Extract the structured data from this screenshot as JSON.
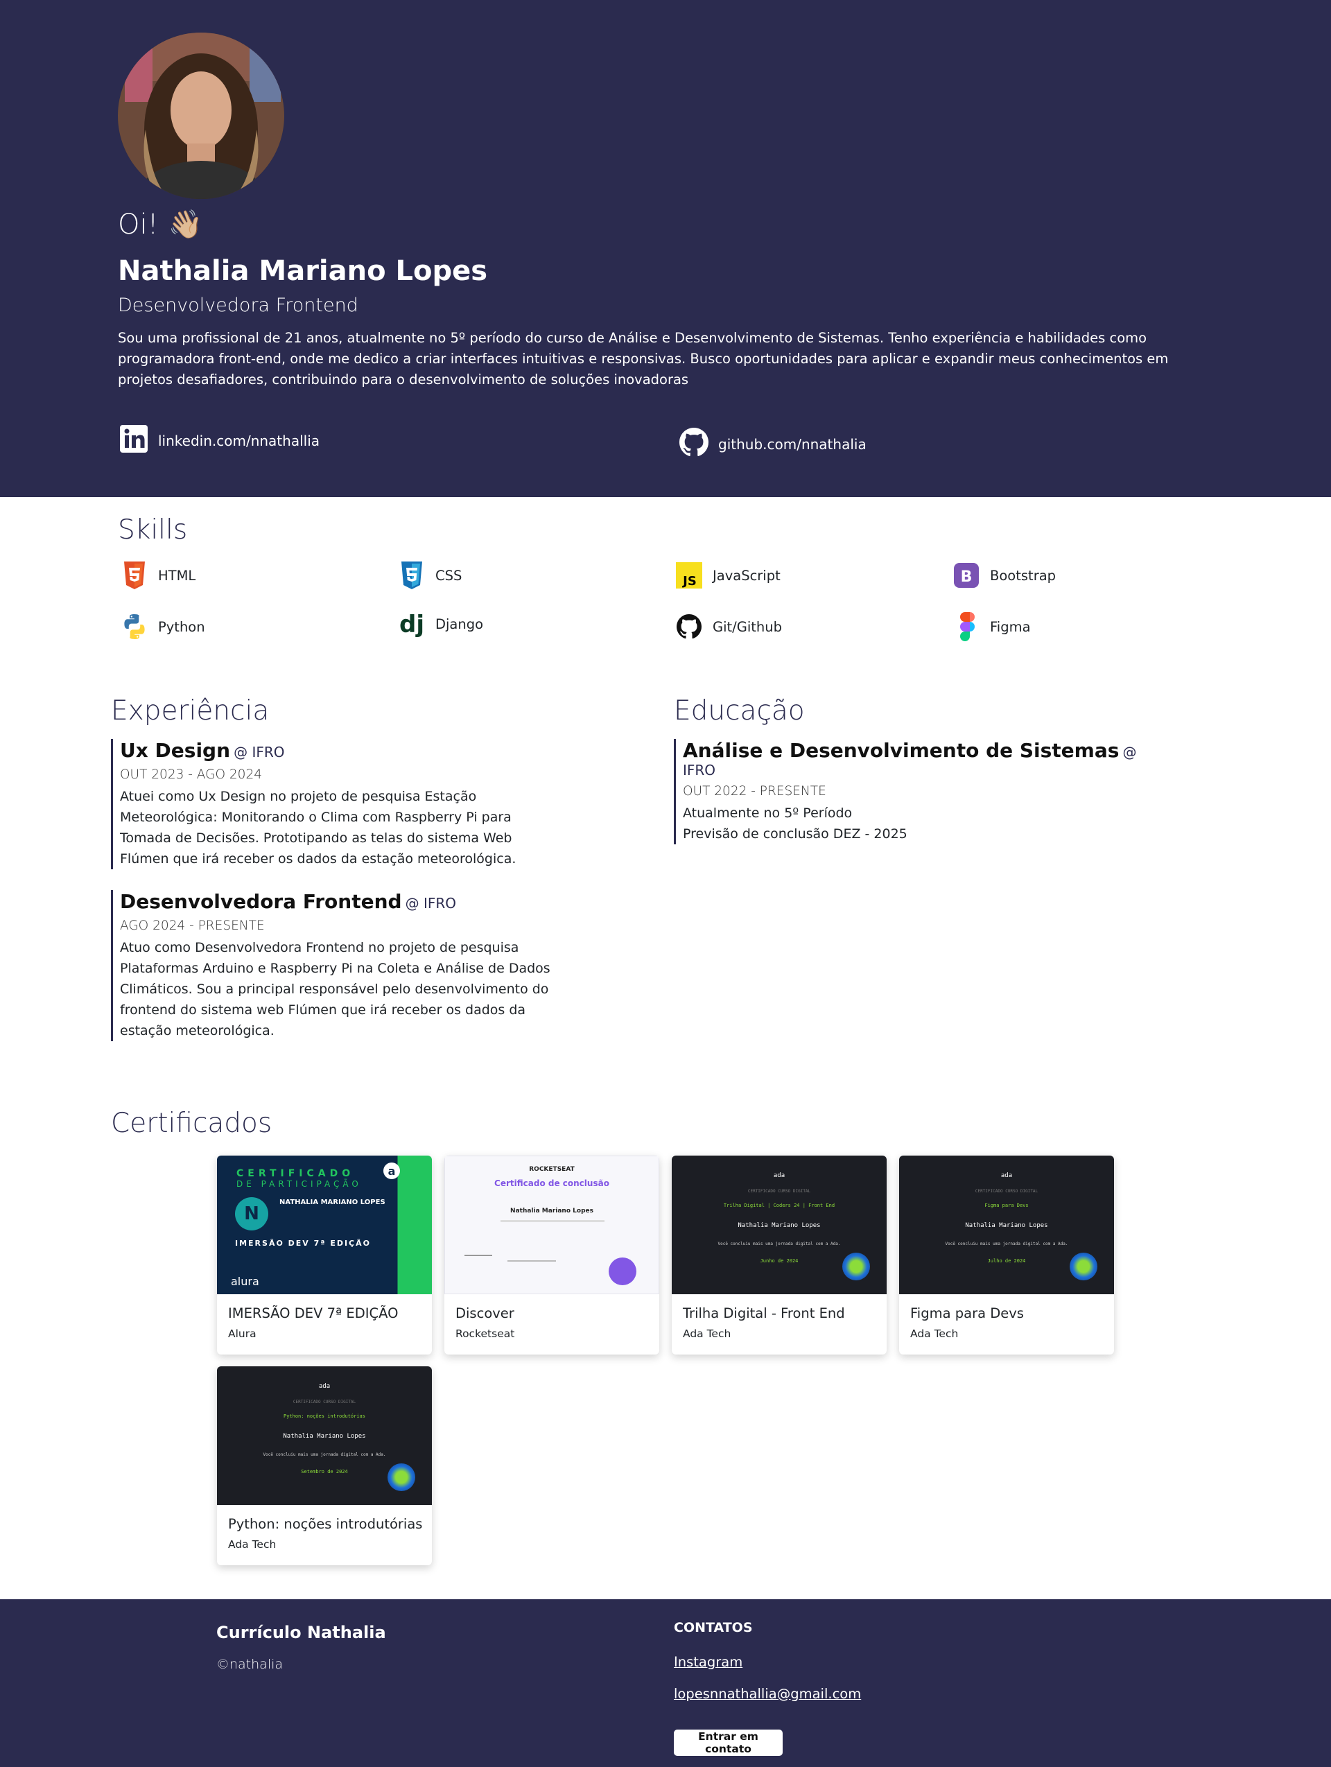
{
  "hero": {
    "greeting": "Oi!",
    "wave_emoji": "👋🏼",
    "name": "Nathalia Mariano Lopes",
    "role": "Desenvolvedora Frontend",
    "bio": "Sou uma profissional de 21 anos, atualmente no 5º período do curso de Análise e Desenvolvimento de Sistemas. Tenho experiência e habilidades como programadora front-end, onde me dedico a criar interfaces intuitivas e responsivas. Busco oportunidades para aplicar e expandir meus conhecimentos em projetos desafiadores, contribuindo para o desenvolvimento de soluções inovadoras",
    "linkedin_label": "linkedin.com/nnathallia",
    "linkedin_icon": "linkedin-icon",
    "github_label": "github.com/nnathalia",
    "github_icon": "github-icon"
  },
  "skills": {
    "title": "Skills",
    "items": [
      {
        "label": "HTML",
        "icon": "html5-icon"
      },
      {
        "label": "CSS",
        "icon": "css3-icon"
      },
      {
        "label": "JavaScript",
        "icon": "javascript-icon"
      },
      {
        "label": "Bootstrap",
        "icon": "bootstrap-icon"
      },
      {
        "label": "Python",
        "icon": "python-icon"
      },
      {
        "label": "Django",
        "icon": "django-icon"
      },
      {
        "label": "Git/Github",
        "icon": "github-icon"
      },
      {
        "label": "Figma",
        "icon": "figma-icon"
      }
    ]
  },
  "experience": {
    "title": "Experiência",
    "items": [
      {
        "title": "Ux Design",
        "org": "@ IFRO",
        "dates": "OUT 2023 - AGO 2024",
        "description": "Atuei como Ux Design no projeto de pesquisa Estação Meteorológica: Monitorando o Clima com Raspberry Pi para Tomada de Decisões. Prototipando as telas do sistema Web Flúmen que irá receber os dados da estação meteorológica."
      },
      {
        "title": "Desenvolvedora Frontend",
        "org": "@ IFRO",
        "dates": "AGO 2024 - PRESENTE",
        "description": "Atuo como Desenvolvedora Frontend no projeto de pesquisa Plataformas Arduino e Raspberry Pi na Coleta e Análise de Dados Climáticos. Sou a principal responsável pelo desenvolvimento do frontend do sistema web Flúmen que irá receber os dados da estação meteorológica."
      }
    ]
  },
  "education": {
    "title": "Educação",
    "items": [
      {
        "title": "Análise e Desenvolvimento de Sistemas",
        "org": "@ IFRO",
        "dates": "OUT 2022 - PRESENTE",
        "line1": "Atualmente no 5º Período",
        "line2": "Previsão de conclusão DEZ - 2025"
      }
    ]
  },
  "certificates": {
    "title": "Certificados",
    "items": [
      {
        "title": "IMERSÃO DEV 7ª EDIÇÃO",
        "issuer": "Alura"
      },
      {
        "title": "Discover",
        "issuer": "Rocketseat"
      },
      {
        "title": "Trilha Digital - Front End",
        "issuer": "Ada Tech"
      },
      {
        "title": "Figma para Devs",
        "issuer": "Ada Tech"
      },
      {
        "title": "Python: noções introdutórias",
        "issuer": "Ada Tech"
      }
    ],
    "alura_img": {
      "heading1": "CERTIFICADO",
      "heading2": "DE PARTICIPAÇÃO",
      "name": "NATHALIA MARIANO LOPES",
      "edition": "IMERSÃO DEV 7ª EDIÇÃO",
      "brand": "alura",
      "badge_letter": "N",
      "corner_letter": "a"
    },
    "rocket_img": {
      "brand": "ROCKETSEAT",
      "heading": "Certificado de conclusão",
      "name": "Nathalia Mariano Lopes"
    },
    "ada_imgs": [
      {
        "brand": "ada",
        "header": "CERTIFICADO CURSO DIGITAL",
        "course": "Trilha Digital | Coders 24 | Front End",
        "name": "Nathalia Mariano Lopes",
        "line": "Você concluiu mais uma jornada digital com a Ada.",
        "date": "Junho de 2024"
      },
      {
        "brand": "ada",
        "header": "CERTIFICADO CURSO DIGITAL",
        "course": "Figma para Devs",
        "name": "Nathalia Mariano Lopes",
        "line": "Você concluiu mais uma jornada digital com a Ada.",
        "date": "Julho de 2024"
      },
      {
        "brand": "ada",
        "header": "CERTIFICADO CURSO DIGITAL",
        "course": "Python: noções introdutórias",
        "name": "Nathalia Mariano Lopes",
        "line": "Você concluiu mais uma jornada digital com a Ada.",
        "date": "Setembro de 2024"
      }
    ]
  },
  "footer": {
    "brand": "Currículo Nathalia",
    "copyright": "©nathalia",
    "contacts_title": "CONTATOS",
    "instagram": "Instagram",
    "email": "lopesnnathallia@gmail.com",
    "button": "Entrar em contato"
  },
  "colors": {
    "primary": "#2b2b4f",
    "alura_green": "#22c55e",
    "ada_bg": "#1c1e24",
    "rocket_purple": "#8257e5"
  }
}
